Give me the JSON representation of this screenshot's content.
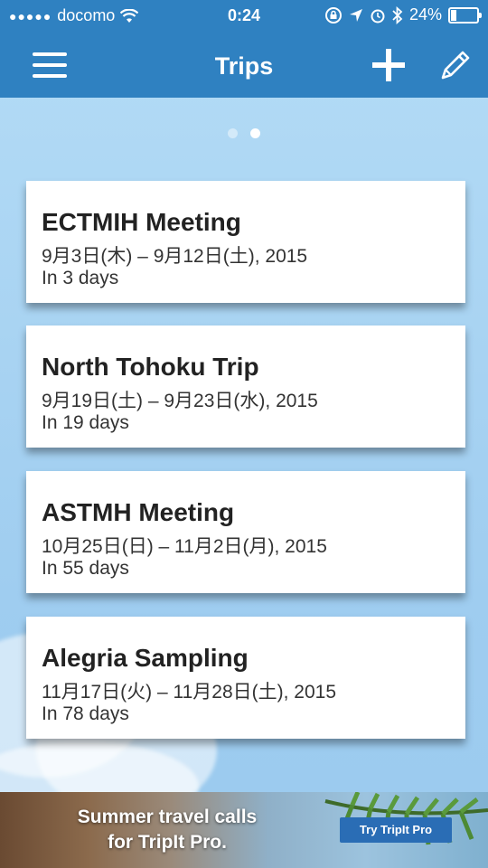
{
  "status_bar": {
    "carrier": "docomo",
    "signal_dots": "●●●●●",
    "time": "0:24",
    "battery_percent": "24%",
    "battery_level": 0.24
  },
  "navbar": {
    "title": "Trips",
    "menu_icon": "hamburger-menu-icon",
    "add_icon": "plus-icon",
    "edit_icon": "pencil-icon"
  },
  "pager": {
    "pages": 2,
    "active": 1
  },
  "trips": [
    {
      "name": "ECTMIH Meeting",
      "dates": "9月3日(木) – 9月12日(土), 2015",
      "until": "In 3 days"
    },
    {
      "name": "North Tohoku Trip",
      "dates": "9月19日(土) – 9月23日(水), 2015",
      "until": "In 19 days"
    },
    {
      "name": "ASTMH Meeting",
      "dates": "10月25日(日) – 11月2日(月), 2015",
      "until": "In 55 days"
    },
    {
      "name": "Alegria Sampling",
      "dates": "11月17日(火) – 11月28日(土), 2015",
      "until": "In 78 days"
    }
  ],
  "ad": {
    "line1": "Summer travel calls",
    "line2": "for TripIt Pro.",
    "cta": "Try TripIt Pro"
  },
  "colors": {
    "nav_blue": "#2f81c1",
    "sky": "#a9d4f3",
    "cta_blue": "#2a6db5"
  }
}
